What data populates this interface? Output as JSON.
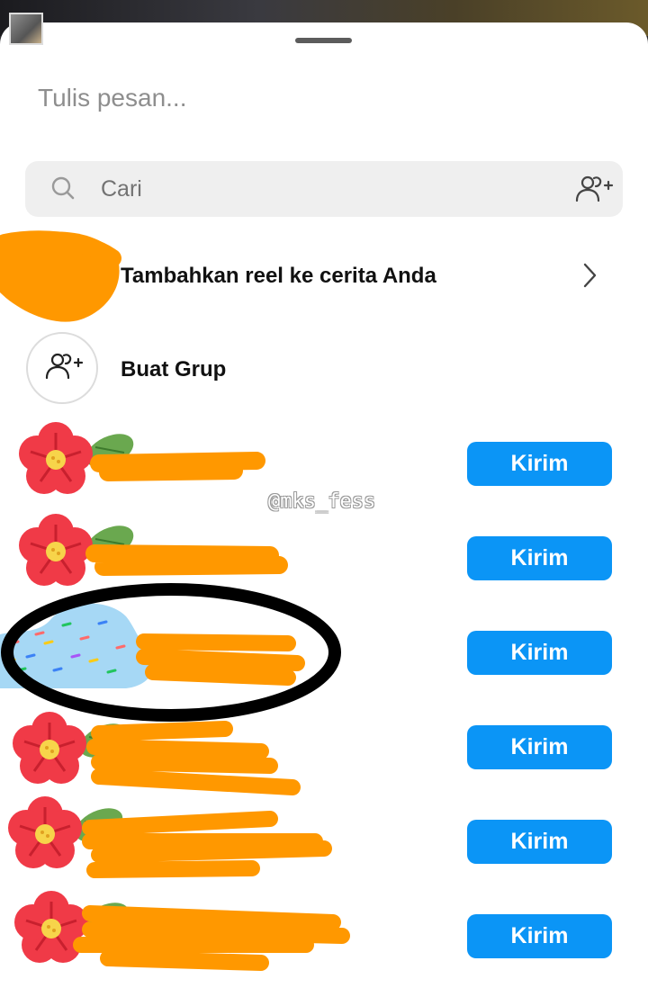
{
  "header": {
    "message_placeholder": "Tulis pesan..."
  },
  "search": {
    "placeholder": "Cari",
    "icon": "search-icon",
    "action_icon": "add-people-icon"
  },
  "actions": {
    "add_reel": "Tambahkan reel ke cerita Anda",
    "create_group": "Buat Grup"
  },
  "recipients": [
    {
      "send_label": "Kirim"
    },
    {
      "send_label": "Kirim"
    },
    {
      "send_label": "Kirim"
    },
    {
      "send_label": "Kirim"
    },
    {
      "send_label": "Kirim"
    },
    {
      "send_label": "Kirim"
    }
  ],
  "watermark": "@mks_fess",
  "colors": {
    "send_button": "#0b95f6",
    "scribble": "#ff9800",
    "circle_outline": "#000000"
  }
}
